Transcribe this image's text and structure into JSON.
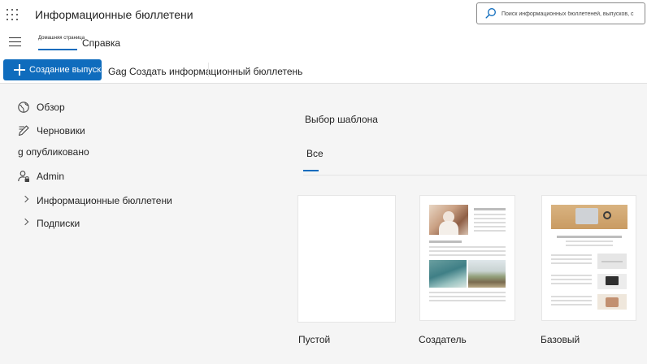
{
  "header": {
    "app_title": "Информационные бюллетени",
    "search_placeholder": "Поиск информационных бюллетеней, выпусков, с"
  },
  "nav": {
    "home_label": "Домашняя страница",
    "help_label": "Справка"
  },
  "command_bar": {
    "create_label": "Создание выпуска",
    "title": "Gag Создать информационный бюллетень"
  },
  "sidebar": {
    "items": [
      {
        "label": "Обзор",
        "icon": "globe-icon"
      },
      {
        "label": "Черновики",
        "icon": "pen-icon"
      },
      {
        "label": "g опубликовано",
        "icon": ""
      },
      {
        "label": "Admin",
        "icon": "person-lock-icon"
      },
      {
        "label": "Информационные бюллетени",
        "icon": "chevron-right-icon"
      },
      {
        "label": "Подписки",
        "icon": "chevron-right-icon"
      }
    ]
  },
  "main": {
    "title": "Выбор шаблона",
    "tabs": [
      {
        "label": "Все",
        "selected": true
      }
    ],
    "templates": [
      {
        "label": "Пустой"
      },
      {
        "label": "Создатель"
      },
      {
        "label": "Базовый"
      }
    ]
  },
  "colors": {
    "accent": "#0f6cbd",
    "background": "#f5f5f5"
  }
}
